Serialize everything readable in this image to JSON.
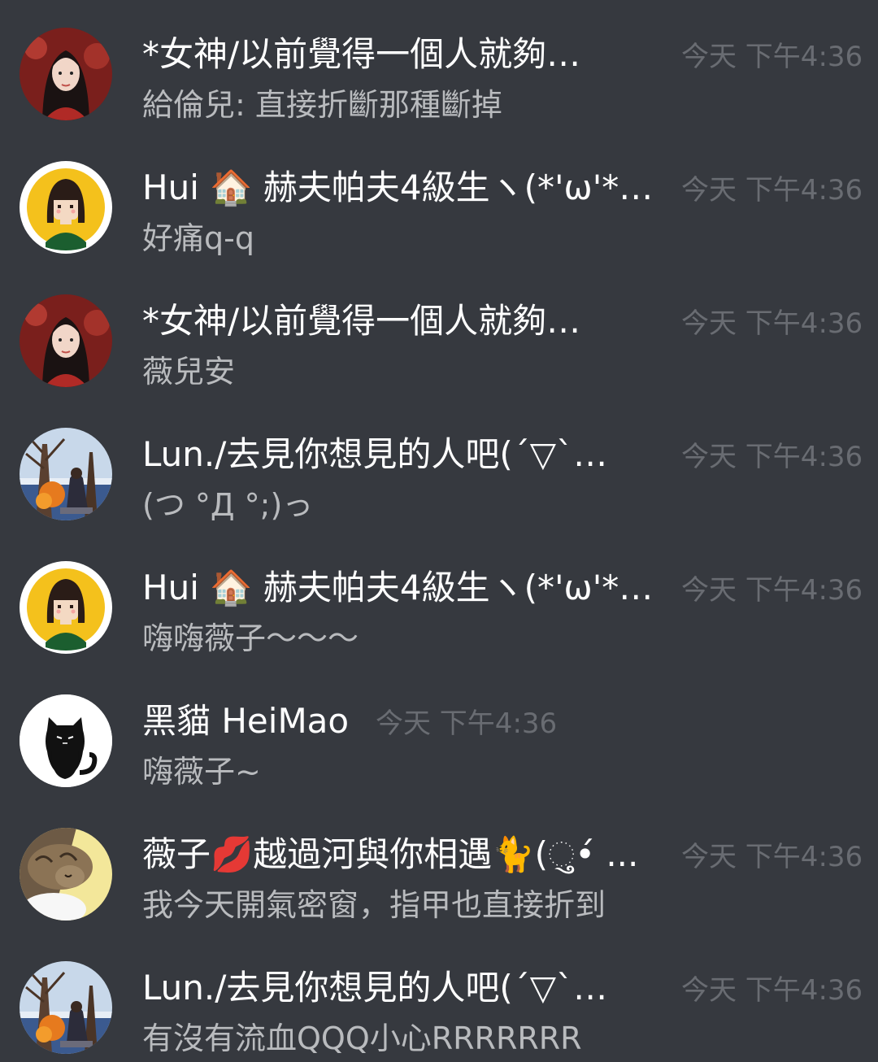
{
  "messages": [
    {
      "author": "*女神/以前覺得一個人就夠…",
      "time": "今天 下午4:36",
      "text": "給倫兒: 直接折斷那種斷掉",
      "avatar": "girl-red-hair-avatar"
    },
    {
      "author": "Hui 🏠 赫夫帕夫4級生ヽ(*'ω'*…",
      "time": "今天 下午4:36",
      "text": "好痛q-q",
      "avatar": "cartoon-girl-yellow-avatar"
    },
    {
      "author": "*女神/以前覺得一個人就夠…",
      "time": "今天 下午4:36",
      "text": "薇兒安",
      "avatar": "girl-red-hair-avatar"
    },
    {
      "author": "Lun./去見你想見的人吧(´▽`…",
      "time": "今天 下午4:36",
      "text": "(つ °Д °;)っ",
      "avatar": "autumn-tree-scene-avatar"
    },
    {
      "author": "Hui 🏠 赫夫帕夫4級生ヽ(*'ω'*…",
      "time": "今天 下午4:36",
      "text": "嗨嗨薇子～～～",
      "avatar": "cartoon-girl-yellow-avatar"
    },
    {
      "author": "黑貓 HeiMao",
      "time": "今天 下午4:36",
      "text": "嗨薇子~",
      "avatar": "black-cat-avatar"
    },
    {
      "author": "薇子💋越過河與你相遇🐈(ુ•́ ...",
      "time": "今天 下午4:36",
      "text": "我今天開氣密窗，指甲也直接折到",
      "avatar": "sleeping-cat-avatar"
    },
    {
      "author": "Lun./去見你想見的人吧(´▽`…",
      "time": "今天 下午4:36",
      "text": "有沒有流血QQQ小心RRRRRRR",
      "avatar": "autumn-tree-scene-avatar"
    }
  ]
}
